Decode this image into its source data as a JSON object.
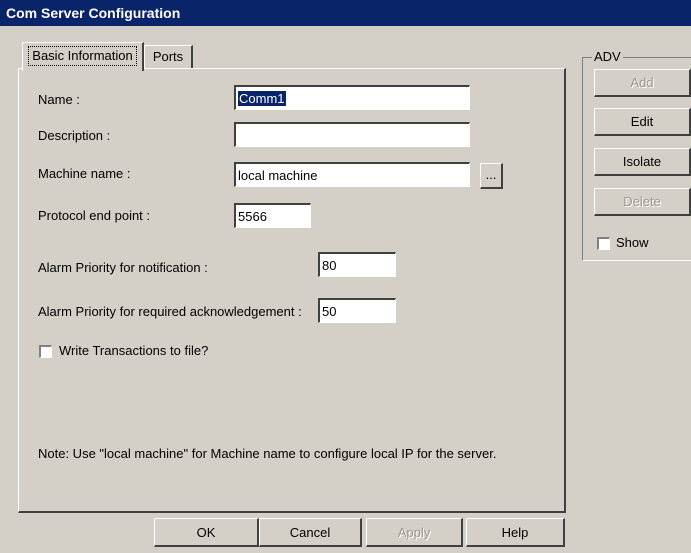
{
  "window": {
    "title": "Com Server Configuration"
  },
  "tabs": [
    {
      "label": "Basic Information"
    },
    {
      "label": "Ports"
    }
  ],
  "form": {
    "name_label": "Name :",
    "name_value": "Comm1",
    "description_label": "Description :",
    "description_value": "",
    "machine_label": "Machine name :",
    "machine_value": "local machine",
    "browse_label": "...",
    "protocol_label": "Protocol end point :",
    "protocol_value": "5566",
    "alarm_notification_label": "Alarm Priority for notification :",
    "alarm_notification_value": "80",
    "alarm_ack_label": "Alarm Priority for required acknowledgement :",
    "alarm_ack_value": "50",
    "write_transactions_label": "Write Transactions to file?",
    "write_transactions_checked": false,
    "note": "Note: Use \"local machine\" for Machine name to configure local IP for the server."
  },
  "adv": {
    "group_label": "ADV",
    "add_label": "Add",
    "edit_label": "Edit",
    "isolate_label": "Isolate",
    "delete_label": "Delete",
    "show_label": "Show",
    "show_checked": false
  },
  "footer": {
    "ok_label": "OK",
    "cancel_label": "Cancel",
    "apply_label": "Apply",
    "help_label": "Help"
  },
  "colors": {
    "titlebar": "#0a246a",
    "face": "#d4d0c8",
    "disabled_text": "#9a9890"
  }
}
